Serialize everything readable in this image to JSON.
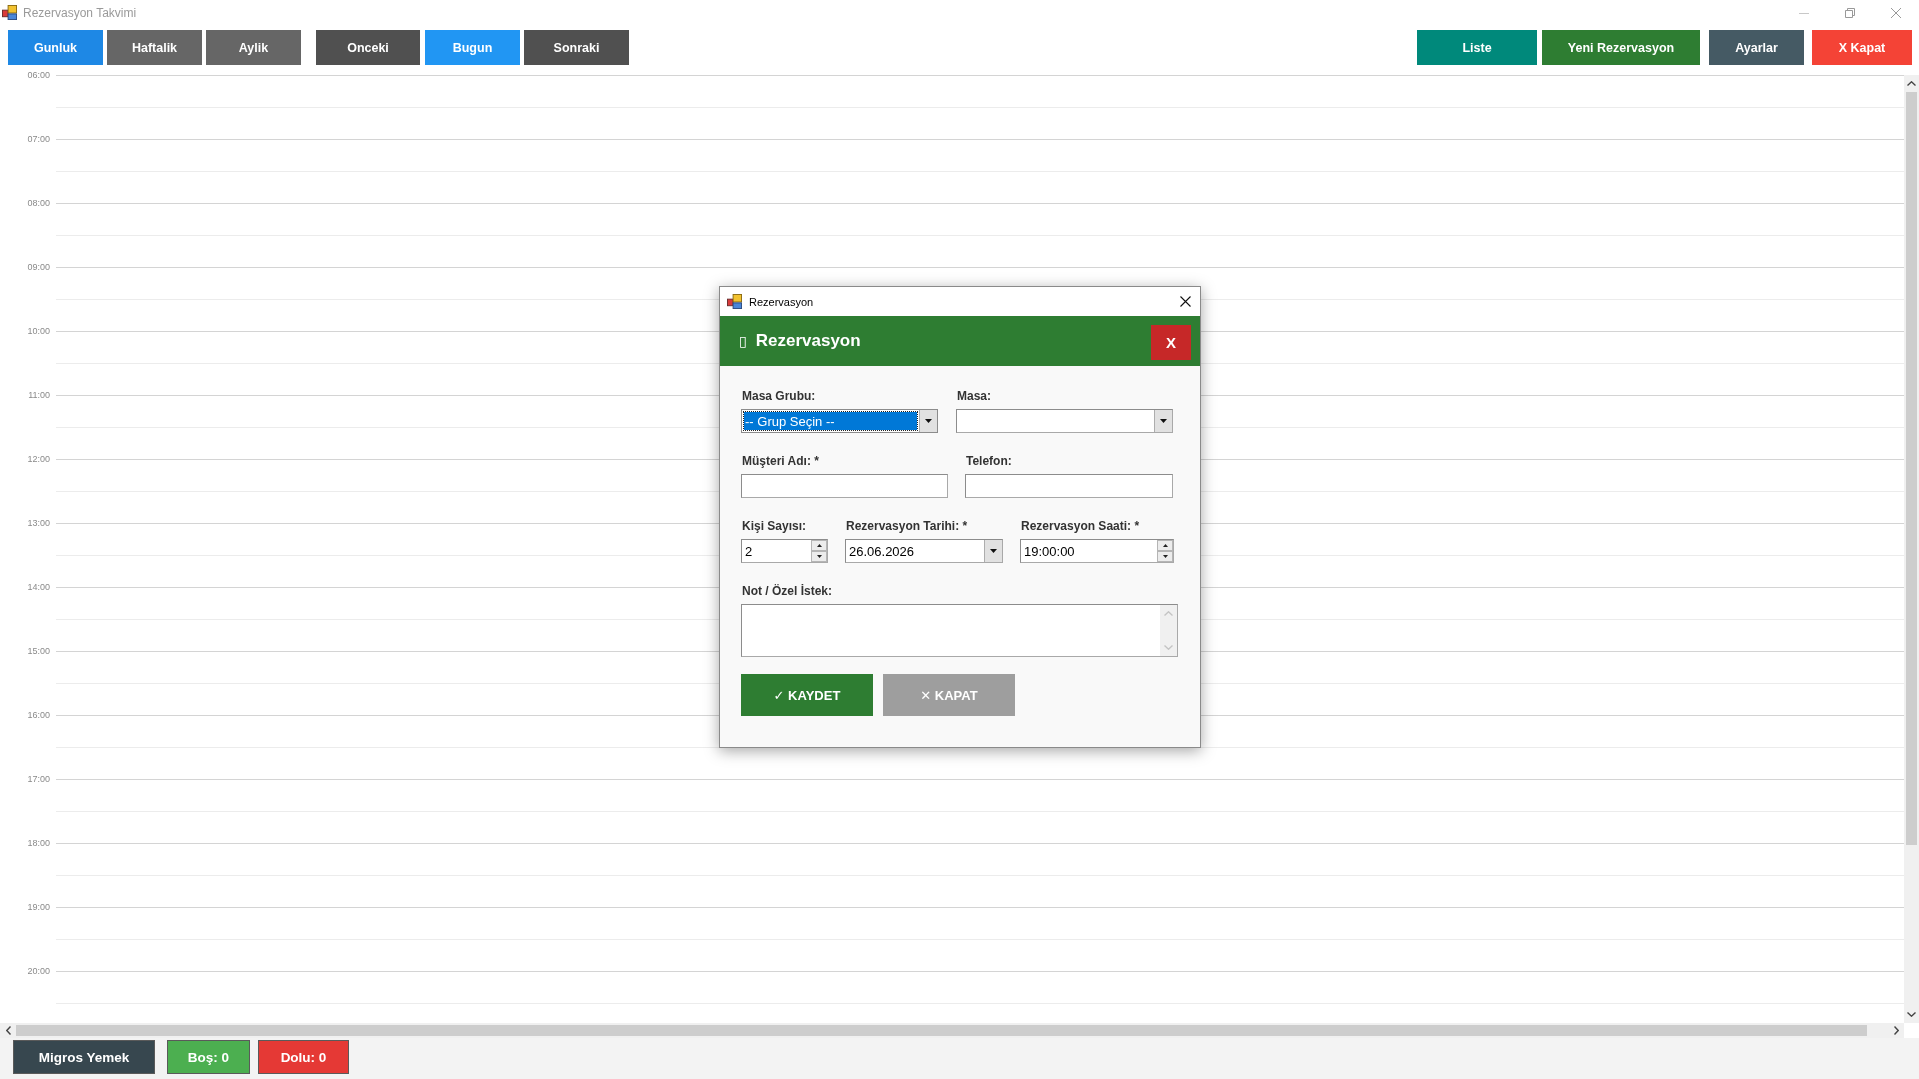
{
  "window": {
    "title": "Rezervasyon Takvimi"
  },
  "toolbar": {
    "view_buttons": [
      {
        "label": "Gunluk",
        "selected": true
      },
      {
        "label": "Haftalik",
        "selected": false
      },
      {
        "label": "Aylik",
        "selected": false
      }
    ],
    "nav_buttons": [
      {
        "label": "Onceki",
        "kind": "step"
      },
      {
        "label": "Bugun",
        "kind": "today"
      },
      {
        "label": "Sonraki",
        "kind": "step"
      }
    ],
    "action_buttons": [
      {
        "label": "Liste",
        "kind": "list"
      },
      {
        "label": "Yeni Rezervasyon",
        "kind": "new"
      },
      {
        "label": "Ayarlar",
        "kind": "settings"
      },
      {
        "label": "X Kapat",
        "kind": "close"
      }
    ]
  },
  "timeline": {
    "hours": [
      "06:00",
      "07:00",
      "08:00",
      "09:00",
      "10:00",
      "11:00",
      "12:00",
      "13:00",
      "14:00",
      "15:00",
      "16:00",
      "17:00",
      "18:00",
      "19:00",
      "20:00"
    ]
  },
  "dialog": {
    "title": "Rezervasyon",
    "header": {
      "glyph": "▯",
      "title": "Rezervasyon",
      "close_label": "X"
    },
    "field_rows": [
      {
        "fields": [
          {
            "label": "Masa Grubu:",
            "kind": "combo",
            "value": "-- Grup Seçin --",
            "focused": true
          },
          {
            "label": "Masa:",
            "kind": "combo",
            "focused": false
          }
        ]
      },
      {
        "fields": [
          {
            "label": "Müşteri Adı: *",
            "kind": "text",
            "focused": false
          },
          {
            "label": "Telefon:",
            "kind": "text",
            "focused": false
          }
        ]
      },
      {
        "fields": [
          {
            "label": "Kişi Sayısı:",
            "kind": "spin",
            "value": "2",
            "focused": false
          },
          {
            "label": "Rezervasyon Tarihi: *",
            "kind": "date",
            "value": "26.06.2026",
            "focused": false
          },
          {
            "label": "Rezervasyon Saati: *",
            "kind": "spin",
            "value": "19:00:00",
            "focused": false
          }
        ]
      },
      {
        "fields": [
          {
            "label": "Not / Özel İstek:",
            "kind": "memo",
            "focused": false
          }
        ]
      }
    ],
    "buttons": [
      {
        "label": "✓ KAYDET",
        "kind": "save"
      },
      {
        "label": "✕ KAPAT",
        "kind": "close"
      }
    ]
  },
  "status_bar": {
    "group": "Migros Yemek",
    "counts": [
      {
        "label": "Boş: 0",
        "kind": "free"
      },
      {
        "label": "Dolu: 0",
        "kind": "occupied"
      }
    ]
  }
}
